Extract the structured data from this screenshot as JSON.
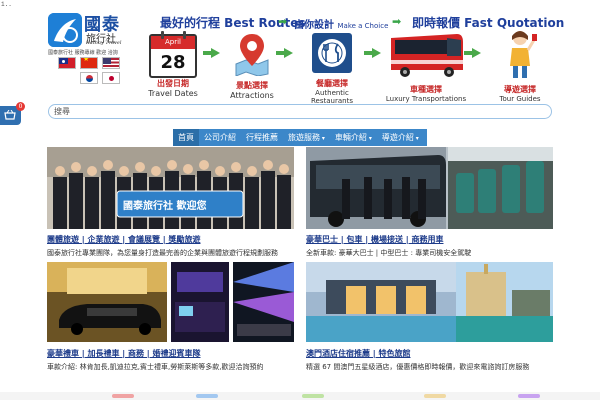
{
  "corner_mark": "1..",
  "brand": {
    "name_zh": "國泰",
    "sub_zh": "旅行社",
    "name_en": "Kathay Travel",
    "tagline": "國泰旅行社 服務專線 歡迎 洽詢"
  },
  "taglines": {
    "left": "最好的行程 Best Routes",
    "middle_zh": "由你設計",
    "middle_en": "Make a Choice",
    "right": "即時報價 Fast Quotation"
  },
  "steps": [
    {
      "zh": "出發日期",
      "en": "Travel Dates"
    },
    {
      "zh": "景點選擇",
      "en": "Attractions"
    },
    {
      "zh": "餐廳選擇",
      "en": "Authentic Restaurants"
    },
    {
      "zh": "車種選擇",
      "en": "Luxury Transportations"
    },
    {
      "zh": "導遊選擇",
      "en": "Tour Guides"
    }
  ],
  "calendar": {
    "month": "April",
    "day": "28"
  },
  "search": {
    "label": "搜尋",
    "placeholder": ""
  },
  "cart": {
    "count": "0"
  },
  "nav": [
    "首頁",
    "公司介紹",
    "行程推薦",
    "旅遊服務",
    "車輛介紹",
    "導遊介紹",
    "美食推薦",
    "聯絡我們"
  ],
  "tiles": [
    {
      "title": "團體旅遊 | 企業旅遊 | 會議展覽 | 獎勵旅遊",
      "desc": "國泰旅行社專業團隊，為您量身打造最完善的企業與團體旅遊行程規劃服務",
      "banner": "國泰旅行社 歡迎您"
    },
    {
      "title": "豪華巴士 | 包車 | 機場接送 | 商務用車",
      "desc": "全新車款: 豪華大巴士 | 中型巴士 : 專業司機安全駕駛"
    },
    {
      "title": "豪華禮車 | 加長禮車 | 商務 | 婚禮迎賓車隊",
      "desc": "車款介紹: 林肯加長,凱迪拉克,賓士禮車,勞斯萊斯等多款,歡迎洽詢預約"
    },
    {
      "title": "澳門酒店住宿推薦 | 特色旅館",
      "desc": "精選 67 間澳門五星級酒店，優惠價格即時報價，歡迎來電諮詢訂房服務"
    }
  ],
  "colors": {
    "brand_blue": "#1e7fd6",
    "nav_blue": "#3c87c9",
    "title_blue": "#1d3b8a",
    "accent_red": "#c62828",
    "arrow_green": "#4aa94a"
  }
}
